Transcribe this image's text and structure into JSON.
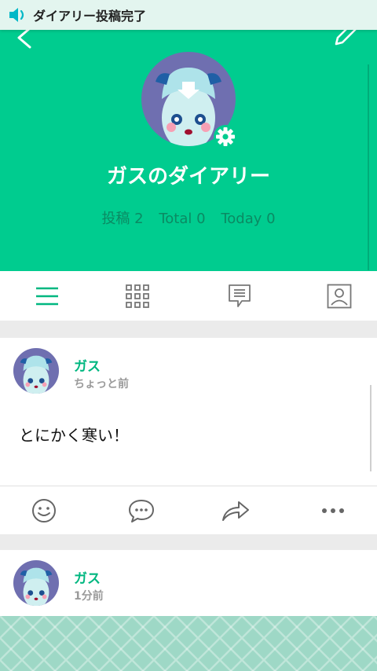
{
  "notification": {
    "text": "ダイアリー投稿完了",
    "icon": "speaker-icon"
  },
  "header": {
    "title": "ガスのダイアリー",
    "stats": {
      "posts": "投稿 2",
      "total": "Total 0",
      "today": "Today 0"
    },
    "back_icon": "chevron-left-icon",
    "edit_icon": "pencil-icon",
    "settings_icon": "gear-icon"
  },
  "tabs": [
    {
      "name": "list",
      "icon": "list-icon"
    },
    {
      "name": "grid",
      "icon": "grid-icon"
    },
    {
      "name": "comments",
      "icon": "comment-icon"
    },
    {
      "name": "profile",
      "icon": "profile-icon"
    }
  ],
  "posts": [
    {
      "author": "ガス",
      "time": "ちょっと前",
      "body": "とにかく寒い！"
    },
    {
      "author": "ガス",
      "time": "1分前"
    }
  ],
  "actions": [
    {
      "name": "like",
      "icon": "smiley-icon"
    },
    {
      "name": "comment",
      "icon": "speech-bubble-icon"
    },
    {
      "name": "share",
      "icon": "share-arrow-icon"
    },
    {
      "name": "more",
      "icon": "more-icon"
    }
  ],
  "colors": {
    "accent": "#00cc8f",
    "author": "#00b780",
    "icon": "#666666"
  }
}
